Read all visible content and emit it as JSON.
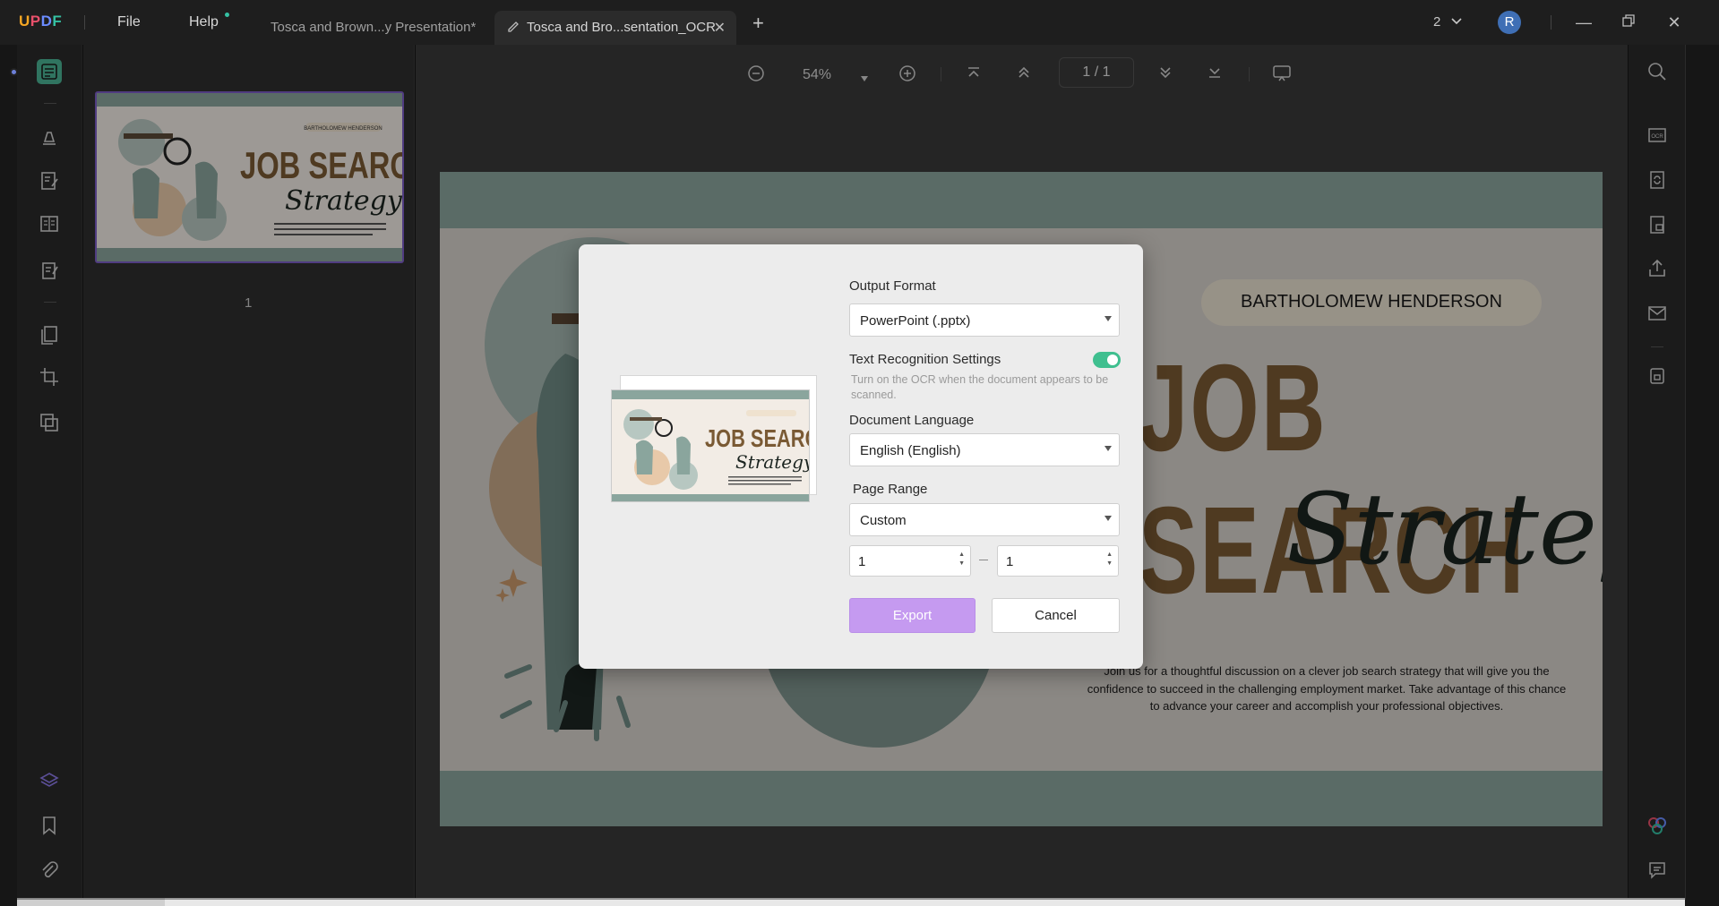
{
  "app": {
    "logo": "UPDF"
  },
  "menu": {
    "file": "File",
    "help": "Help"
  },
  "tabs": [
    {
      "label": "Tosca and Brown...y Presentation*"
    },
    {
      "label": "Tosca and Bro...sentation_OCR"
    }
  ],
  "window": {
    "page_count_label": "2",
    "avatar_letter": "R"
  },
  "viewer": {
    "zoom": "54%",
    "page_current": "1",
    "page_total": "1",
    "page_indicator": "1 / 1"
  },
  "thumbnails": {
    "items": [
      {
        "page_label": "1"
      }
    ]
  },
  "slide": {
    "speaker": "BARTHOLOMEW HENDERSON",
    "headline": "JOB SEARCH",
    "script_word": "Strategy",
    "body": "Join us for a thoughtful discussion on a clever job search strategy that will give you the confidence to succeed in the challenging employment market. Take advantage of this chance to advance your career and accomplish your professional objectives."
  },
  "dialog": {
    "output_format_label": "Output Format",
    "output_format_value": "PowerPoint (.pptx)",
    "ocr_label": "Text Recognition Settings",
    "ocr_enabled": true,
    "ocr_hint": "Turn on the OCR when the document appears to be scanned.",
    "language_label": "Document Language",
    "language_value": "English (English)",
    "page_range_label": "Page Range",
    "page_range_value": "Custom",
    "range_from": "1",
    "range_to": "1",
    "export_label": "Export",
    "cancel_label": "Cancel",
    "export_color": "#c59af0"
  },
  "colors": {
    "accent_green": "#4bb394",
    "slide_band": "#8aa59d",
    "headline_brown": "#7a5a34"
  }
}
